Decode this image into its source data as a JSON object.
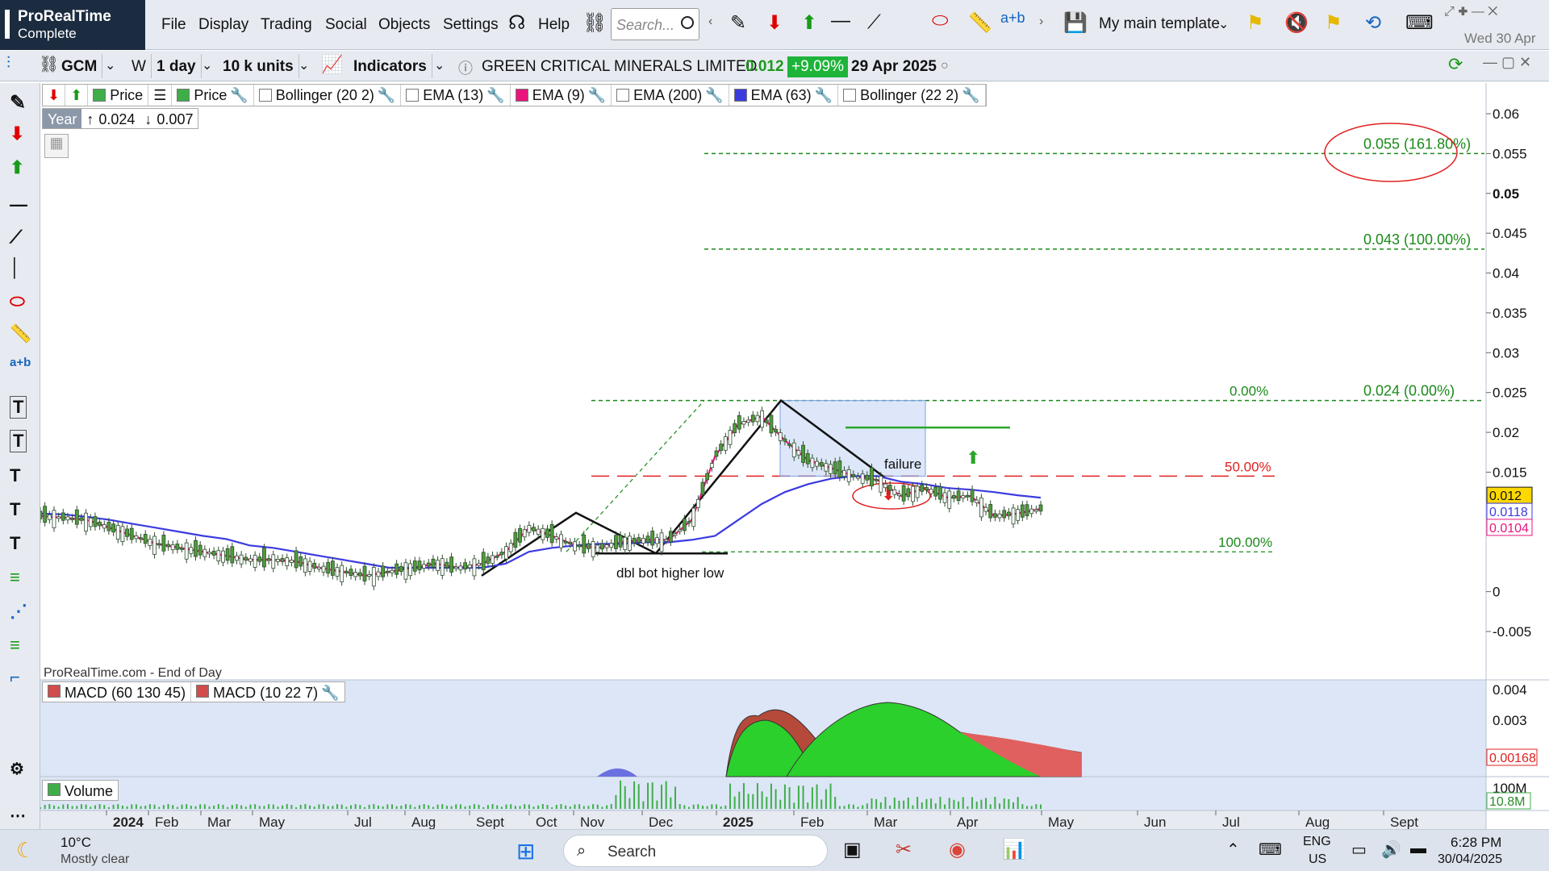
{
  "app": {
    "name": "ProRealTime",
    "edition": "Complete"
  },
  "menu": [
    "File",
    "Display",
    "Trading",
    "Social",
    "Objects",
    "Settings"
  ],
  "help_label": "Help",
  "search_placeholder": "Search...",
  "template_label": "My main template",
  "date_label": "Wed 30 Apr",
  "symbol": {
    "ticker": "GCM",
    "period_code": "W",
    "timeframe": "1 day",
    "units": "10 k units",
    "indicators_label": "Indicators",
    "name": "GREEN CRITICAL MINERALS LIMITED",
    "price": "0.012",
    "change": "+9.09%",
    "date": "29 Apr 2025"
  },
  "indicators": [
    {
      "label": "Price",
      "color": "#3fae49"
    },
    {
      "label": "Price",
      "color": "#3fae49"
    },
    {
      "label": "Bollinger (20 2)",
      "color": "#ffffff"
    },
    {
      "label": "EMA (13)",
      "color": "#ffffff"
    },
    {
      "label": "EMA (9)",
      "color": "#e8157d"
    },
    {
      "label": "EMA (200)",
      "color": "#ffffff"
    },
    {
      "label": "EMA (63)",
      "color": "#3b3be0"
    },
    {
      "label": "Bollinger (22 2)",
      "color": "#ffffff"
    }
  ],
  "year_box": {
    "label": "Year",
    "high": "0.024",
    "low": "0.007"
  },
  "footer_note": "ProRealTime.com - End of Day",
  "macd_labels": [
    "MACD (60 130 45)",
    "MACD (10 22 7)"
  ],
  "volume_label": "Volume",
  "chart_data": {
    "type": "line",
    "price_axis_ticks": [
      "0.06",
      "0.055",
      "0.05",
      "0.045",
      "0.04",
      "0.035",
      "0.03",
      "0.025",
      "0.02",
      "0.015",
      "0",
      "-0.005"
    ],
    "ylim": [
      -0.005,
      0.06
    ],
    "price_badges": [
      "0.012",
      "0.0118",
      "0.0104"
    ],
    "x_tick_labels": [
      "2024",
      "Feb",
      "Mar",
      "May",
      "Jul",
      "Aug",
      "Sept",
      "Oct",
      "Nov",
      "Dec",
      "2025",
      "Feb",
      "Mar",
      "Apr",
      "May",
      "Jun",
      "Jul",
      "Aug",
      "Sept"
    ],
    "fib_levels": [
      {
        "label": "0.055 (161.80%)",
        "value": 0.055
      },
      {
        "label": "0.043 (100.00%)",
        "value": 0.043
      },
      {
        "label": "0.024 (0.00%)",
        "value": 0.024
      }
    ],
    "retracement_labels": [
      "0.00%",
      "50.00%",
      "100.00%"
    ],
    "retracement_values": [
      0.024,
      0.0145,
      0.005
    ],
    "annotations": [
      "failure",
      "dbl bot higher low"
    ],
    "macd_axis_ticks": [
      "0.004",
      "0.003"
    ],
    "macd_badge": "0.00168",
    "volume_axis_ticks": [
      "100M"
    ],
    "volume_badge": "10.8M",
    "series": [
      {
        "name": "EMA (9)",
        "color": "#e8157d",
        "values": [
          0.0095,
          0.0093,
          0.009,
          0.008,
          0.007,
          0.006,
          0.0055,
          0.005,
          0.0045,
          0.004,
          0.004,
          0.0038,
          0.003,
          0.0025,
          0.002,
          0.0025,
          0.003,
          0.0035,
          0.003,
          0.0035,
          0.005,
          0.008,
          0.007,
          0.0058,
          0.0055,
          0.0062,
          0.0065,
          0.0065,
          0.009,
          0.017,
          0.021,
          0.022,
          0.019,
          0.0165,
          0.0155,
          0.0145,
          0.014,
          0.012,
          0.013,
          0.0118,
          0.012,
          0.0095,
          0.0098,
          0.0104
        ]
      },
      {
        "name": "EMA (63)",
        "color": "#3b3be0",
        "values": [
          0.0098,
          0.0097,
          0.0094,
          0.009,
          0.0085,
          0.008,
          0.0075,
          0.007,
          0.0066,
          0.0058,
          0.0055,
          0.005,
          0.0045,
          0.004,
          0.0035,
          0.003,
          0.003,
          0.003,
          0.003,
          0.003,
          0.0035,
          0.005,
          0.0055,
          0.0058,
          0.006,
          0.006,
          0.0062,
          0.0062,
          0.0065,
          0.007,
          0.009,
          0.011,
          0.0125,
          0.0135,
          0.0142,
          0.0145,
          0.0145,
          0.0138,
          0.0135,
          0.013,
          0.0128,
          0.0125,
          0.0121,
          0.0118
        ]
      }
    ]
  },
  "taskbar": {
    "temp": "10°C",
    "weather": "Mostly clear",
    "search": "Search",
    "lang": "ENG",
    "region": "US",
    "time": "6:28 PM",
    "date": "30/04/2025"
  }
}
